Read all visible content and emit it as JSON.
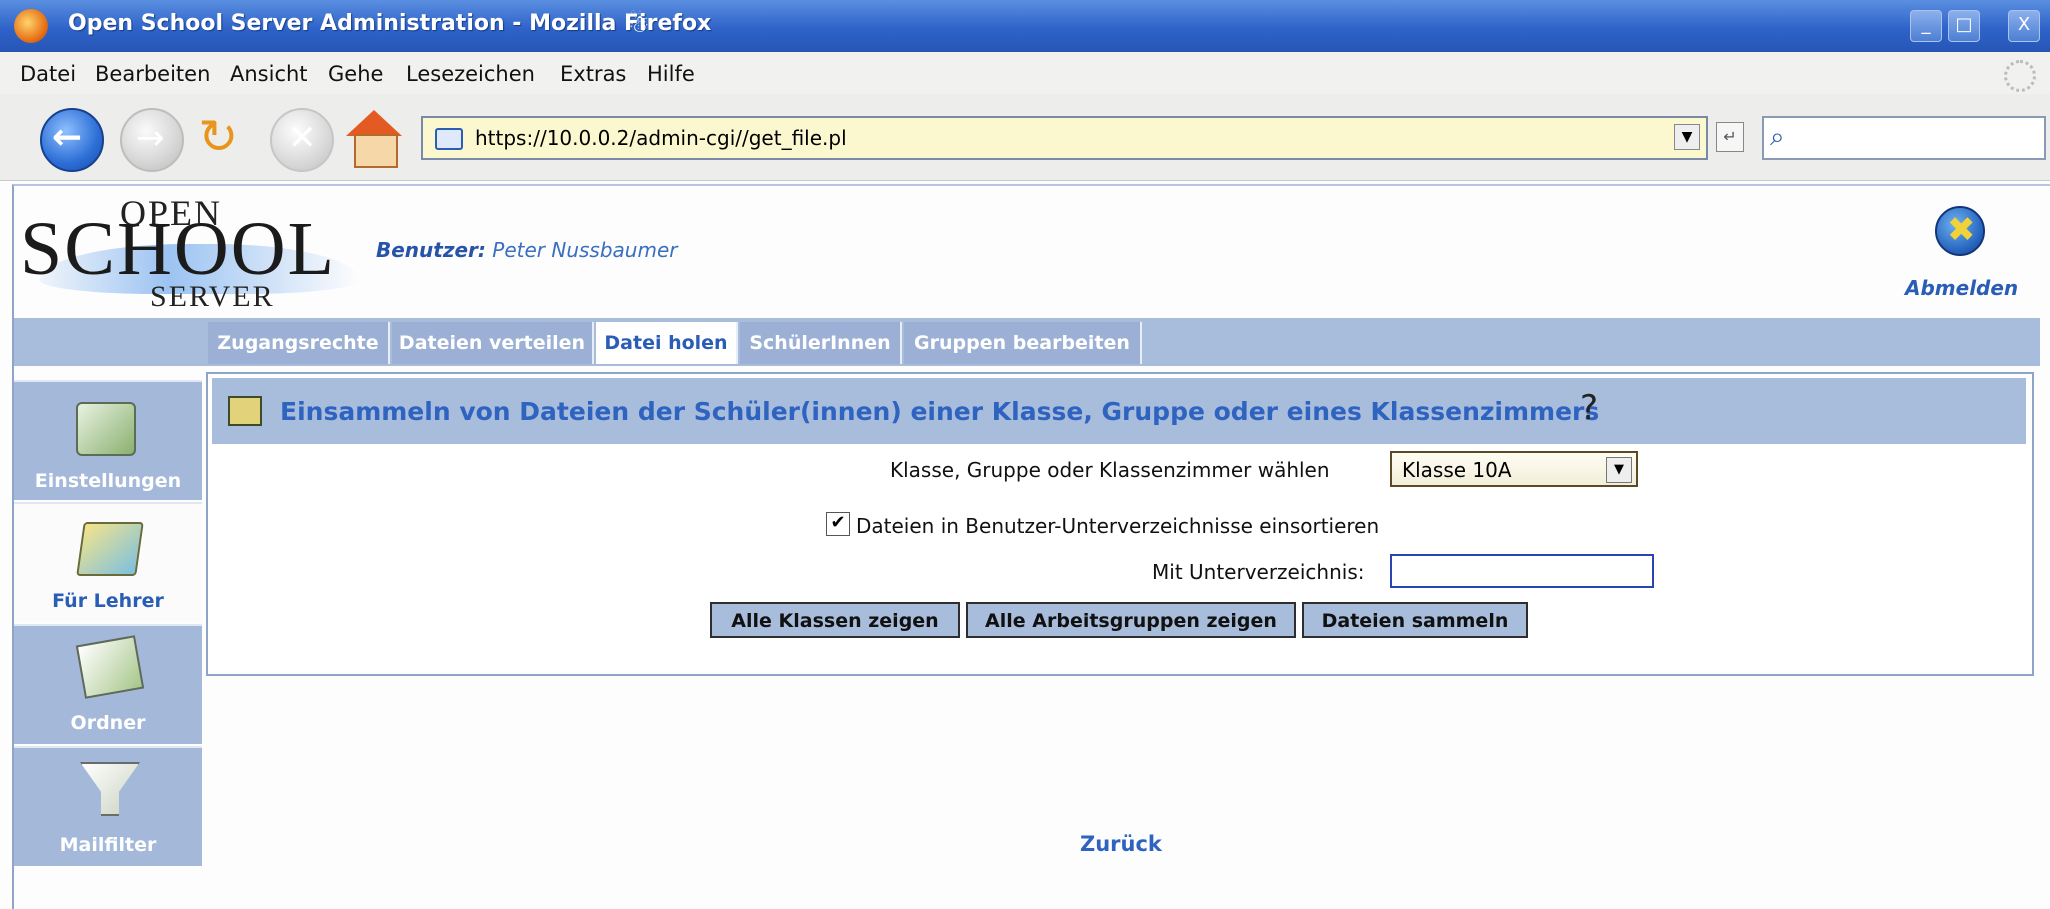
{
  "window": {
    "title": "Open School Server Administration - Mozilla Firefox",
    "title_glyph": "☃",
    "controls": {
      "minimize": "_",
      "restore": "□",
      "close": "X"
    }
  },
  "menu": [
    "Datei",
    "Bearbeiten",
    "Ansicht",
    "Gehe",
    "Lesezeichen",
    "Extras",
    "Hilfe"
  ],
  "nav": {
    "back_glyph": "←",
    "forward_glyph": "→",
    "reload_glyph": "↻",
    "stop_glyph": "✕",
    "url": "https://10.0.0.2/admin-cgi//get_file.pl",
    "dropdown_glyph": "▼",
    "go_glyph": "↵",
    "search_glyph": "⌕"
  },
  "logo": {
    "line1": "OPEN",
    "line2": "SCHOOL",
    "line3": "SERVER"
  },
  "user": {
    "label": "Benutzer:",
    "name": "Peter Nussbaumer"
  },
  "logout": {
    "label": "Abmelden",
    "glyph": "✖"
  },
  "tabs": [
    {
      "label": "Zugangsrechte",
      "active": false
    },
    {
      "label": "Dateien verteilen",
      "active": false
    },
    {
      "label": "Datei holen",
      "active": true
    },
    {
      "label": "SchülerInnen",
      "active": false
    },
    {
      "label": "Gruppen bearbeiten",
      "active": false
    }
  ],
  "sidebar": [
    {
      "label": "Einstellungen",
      "icon": "settings-icon",
      "active": false
    },
    {
      "label": "Für Lehrer",
      "icon": "teacher-icon",
      "active": true
    },
    {
      "label": "Ordner",
      "icon": "folder-icon",
      "active": false
    },
    {
      "label": "Mailfilter",
      "icon": "mailfilter-icon",
      "active": false
    }
  ],
  "content": {
    "heading": "Einsammeln von Dateien der Schüler(innen) einer Klasse, Gruppe oder eines Klassenzimmers",
    "help_glyph": "?",
    "select_label": "Klasse, Gruppe oder Klassenzimmer wählen",
    "select_value": "Klasse 10A",
    "checkbox_label": "Dateien in Benutzer-Unterverzeichnisse einsortieren",
    "checkbox_checked": true,
    "check_glyph": "✔",
    "subdir_label": "Mit Unterverzeichnis:",
    "subdir_value": "",
    "buttons": {
      "show_classes": "Alle Klassen zeigen",
      "show_groups": "Alle Arbeitsgruppen zeigen",
      "collect": "Dateien sammeln"
    }
  },
  "back_link": "Zurück",
  "colors": {
    "titlebar": "#2f63c9",
    "tab_bg": "#a8bcdc",
    "accent_text": "#2f63c0"
  }
}
